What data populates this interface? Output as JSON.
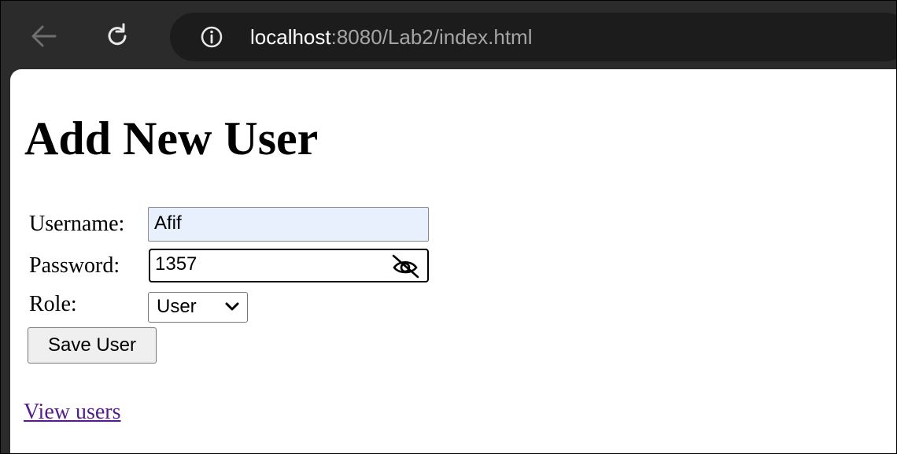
{
  "browser": {
    "url_host": "localhost",
    "url_path": ":8080/Lab2/index.html",
    "icons": {
      "back": "back-arrow-icon",
      "reload": "reload-icon",
      "info": "info-icon"
    }
  },
  "page": {
    "title": "Add New User",
    "form": {
      "username_label": "Username:",
      "username_value": "Afif",
      "password_label": "Password:",
      "password_value": "1357",
      "password_toggle_icon": "eye-slash-icon",
      "role_label": "Role:",
      "role_selected": "User",
      "save_label": "Save User"
    },
    "view_users_link": "View users"
  },
  "colors": {
    "toolbar_bg": "#2b2b2b",
    "omnibox_bg": "#1c1c1c",
    "autofill_bg": "#e8f0fe",
    "visited_link": "#551a8b"
  }
}
